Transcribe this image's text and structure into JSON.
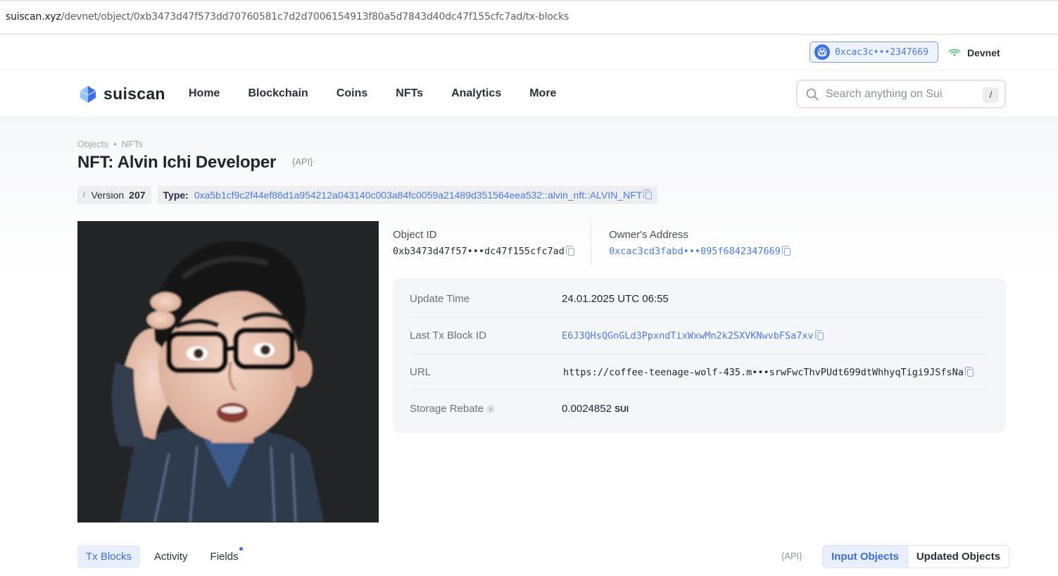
{
  "browser": {
    "url_host": "suiscan.xyz",
    "url_path": "/devnet/object/0xb3473d47f573dd70760581c7d2d7006154913f80a5d7843d40dc47f155cfc7ad/tx-blocks"
  },
  "topbar": {
    "wallet_address": "0xcac3c•••2347669",
    "network": "Devnet"
  },
  "nav": {
    "logo_text": "suiscan",
    "items": [
      "Home",
      "Blockchain",
      "Coins",
      "NFTs",
      "Analytics",
      "More"
    ],
    "search_placeholder": "Search anything on Sui",
    "search_shortcut": "/"
  },
  "page": {
    "breadcrumb": [
      "Objects",
      "NFTs"
    ],
    "breadcrumb_sep": "•",
    "title": "NFT: Alvin Ichi Developer",
    "api_label": "{API}",
    "version_label": "Version",
    "version": "207",
    "type_label": "Type:",
    "type_value": "0xa5b1cf9c2f44ef86d1a954212a043140c003a84fc0059a21489d351564eea532::alvin_nft::ALVIN_NFT"
  },
  "ids": {
    "object_id_label": "Object ID",
    "object_id": "0xb3473d47f57•••dc47f155cfc7ad",
    "owner_label": "Owner's Address",
    "owner": "0xcac3cd3fabd•••095f6842347669"
  },
  "details": [
    {
      "key": "Update Time",
      "value": "24.01.2025 UTC 06:55"
    },
    {
      "key": "Last Tx Block ID",
      "value": "E6J3QHsQGnGLd3PpxndTixWxwMn2k2SXVKNwvbFSa7xv"
    },
    {
      "key": "URL",
      "value": "https://coffee-teenage-wolf-435.m•••srwFwcThvPUdt699dtWhhyqTigi9JSfsNa"
    },
    {
      "key": "Storage Rebate",
      "value": "0.0024852",
      "unit": "SUI"
    }
  ],
  "tabs": {
    "items": [
      "Tx Blocks",
      "Activity",
      "Fields"
    ],
    "active": "Tx Blocks",
    "api_label": "{API}",
    "segments": [
      "Input Objects",
      "Updated Objects"
    ],
    "active_segment": "Input Objects"
  },
  "colors": {
    "accent": "#3b6ff0",
    "link": "#4a79f0"
  }
}
